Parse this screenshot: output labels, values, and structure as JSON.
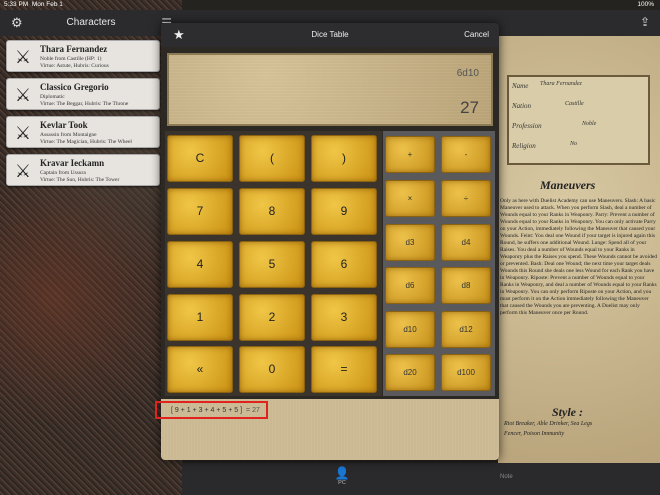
{
  "status": {
    "time": "5:33 PM",
    "date": "Mon Feb 1",
    "battery": "100%"
  },
  "left": {
    "title": "Characters",
    "characters": [
      {
        "name": "Thara Fernandez",
        "line1": "Noble from Castille (HP: 1)",
        "line2": "Virtue: Astute, Hubris: Curious"
      },
      {
        "name": "Classico Gregorio",
        "line1": "Diplomatic",
        "line2": "Virtue: The Beggar, Hubris: The Throne"
      },
      {
        "name": "Kevlar Took",
        "line1": "Assassin from Montaigne",
        "line2": "Virtue: The Magician, Hubris: The Wheel"
      },
      {
        "name": "Kravar Ieckamn",
        "line1": "Captain from Ussura",
        "line2": "Virtue: The Sun, Hubris: The Tower"
      }
    ]
  },
  "modal": {
    "title": "Dice Table",
    "cancel": "Cancel",
    "display": {
      "expression": "6d10",
      "result": "27"
    },
    "keys": [
      "C",
      "(",
      ")",
      "7",
      "8",
      "9",
      "4",
      "5",
      "6",
      "1",
      "2",
      "3",
      "«",
      "0",
      "="
    ],
    "side_keys": [
      "+",
      "-",
      "×",
      "÷",
      "d3",
      "d4",
      "d6",
      "d8",
      "d10",
      "d12",
      "d20",
      "d100"
    ],
    "history": {
      "roll": "[ 9 + 1 + 3 + 4 + 5 + 5 ]",
      "sum": "= 27"
    }
  },
  "sheet": {
    "name_label": "Name",
    "name_value": "Thara Fernandez",
    "nation_label": "Nation",
    "nation_value": "Castille",
    "profession_label": "Profession",
    "profession_value": "Noble",
    "religion_label": "Religion",
    "religion_value": "No",
    "maneuvers_title": "Maneuvers",
    "maneuvers_text": "Only as here with Duelist Academy can use Maneuvers. Slash: A basic Maneuver used to attack. When you perform Slash, deal a number of Wounds equal to your Ranks in Weaponry. Parry: Prevent a number of Wounds equal to your Ranks in Weaponry. You can only activate Parry on your Action, immediately following the Maneuver that caused your Wounds. Feint: You deal one Wound if your target is injured again this Round, he suffers one additional Wound. Lunge: Spend all of your Raises. You deal a number of Wounds equal to your Ranks in Weaponry plus the Raises you spend. These Wounds cannot be avoided or prevented. Bash: Deal one Wound; the next time your target deals Wounds this Round she deals one less Wound for each Rank you have in Weaponry. Riposte: Prevent a number of Wounds equal to your Ranks in Weaponry, and deal a number of Wounds equal to your Ranks in Weaponry. You can only perform Riposte on your Action, and you must perform it on the Action immediately following the Maneuver that caused the Wounds you are preventing. A Duelist may only perform this Maneuver once per Round.",
    "style_title": "Style :",
    "style_line1": "Riot Breaker, Able Drinker, Sea Legs",
    "style_line2": "Fencer, Poison Immunity"
  },
  "tabs": {
    "pc": "PC",
    "note": "Note"
  }
}
